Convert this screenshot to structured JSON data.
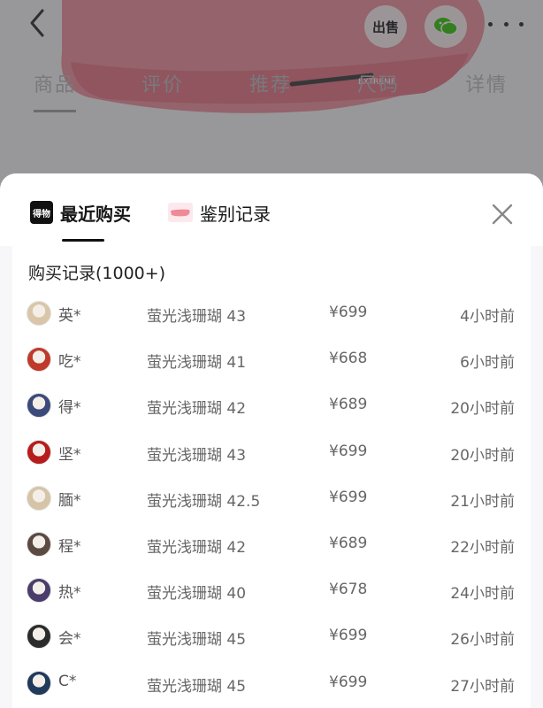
{
  "background": {
    "tabs": [
      "商品",
      "评价",
      "推荐",
      "尺码",
      "详情"
    ],
    "sell_label": "出售",
    "icons": {
      "back": "back-arrow-icon",
      "wechat": "wechat-icon",
      "more": "more-dots-icon"
    }
  },
  "sheet": {
    "tabs": [
      {
        "label": "最近购买",
        "icon": "dewu-logo-icon",
        "logo_text": "得物",
        "active": true
      },
      {
        "label": "鉴别记录",
        "icon": "shoe-thumbnail-icon",
        "active": false
      }
    ],
    "close_icon": "close-icon",
    "records_title": "购买记录(1000+)",
    "records": [
      {
        "buyer": "英*",
        "spec": "萤光浅珊瑚 43",
        "price": "¥699",
        "time": "4小时前"
      },
      {
        "buyer": "吃*",
        "spec": "萤光浅珊瑚 41",
        "price": "¥668",
        "time": "6小时前"
      },
      {
        "buyer": "得*",
        "spec": "萤光浅珊瑚 42",
        "price": "¥689",
        "time": "20小时前"
      },
      {
        "buyer": "坚*",
        "spec": "萤光浅珊瑚 43",
        "price": "¥699",
        "time": "20小时前"
      },
      {
        "buyer": "腼*",
        "spec": "萤光浅珊瑚 42.5",
        "price": "¥699",
        "time": "21小时前"
      },
      {
        "buyer": "程*",
        "spec": "萤光浅珊瑚 42",
        "price": "¥689",
        "time": "22小时前"
      },
      {
        "buyer": "热*",
        "spec": "萤光浅珊瑚 40",
        "price": "¥678",
        "time": "24小时前"
      },
      {
        "buyer": "会*",
        "spec": "萤光浅珊瑚 45",
        "price": "¥699",
        "time": "26小时前"
      },
      {
        "buyer": "C*",
        "spec": "萤光浅珊瑚 45",
        "price": "¥699",
        "time": "27小时前"
      }
    ]
  },
  "colors": {
    "accent_text": "#161616",
    "shoe_pink": "#ef8a96",
    "wechat_green": "#2dc100"
  }
}
